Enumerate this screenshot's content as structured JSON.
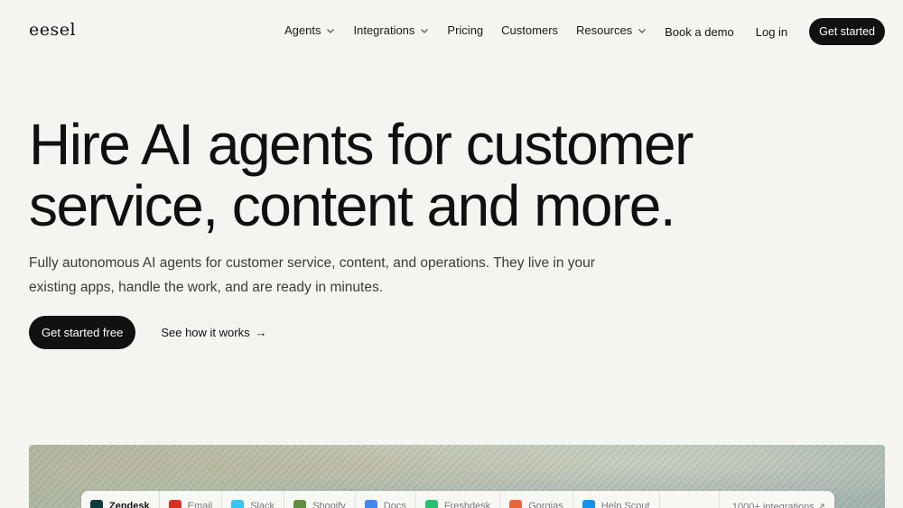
{
  "header": {
    "logo": "eesel",
    "nav": [
      {
        "label": "Agents",
        "has_dropdown": true
      },
      {
        "label": "Integrations",
        "has_dropdown": true
      },
      {
        "label": "Pricing",
        "has_dropdown": false
      },
      {
        "label": "Customers",
        "has_dropdown": false
      },
      {
        "label": "Resources",
        "has_dropdown": true
      }
    ],
    "book_demo": "Book a demo",
    "login": "Log in",
    "get_started": "Get started"
  },
  "hero": {
    "title_line1": "Hire AI agents for customer",
    "title_line2": "service, content and more.",
    "subtitle": "Fully autonomous AI agents for customer service, content, and operations. They live in your existing apps, handle the work, and are ready in minutes.",
    "cta_primary": "Get started free",
    "cta_secondary": "See how it works",
    "cta_secondary_arrow": "→"
  },
  "integrations_tabs": [
    {
      "label": "Zendesk",
      "icon": "zendesk-icon",
      "color": "#0f3b3a",
      "active": true
    },
    {
      "label": "Email",
      "icon": "gmail-icon",
      "color": "#d93025",
      "active": false
    },
    {
      "label": "Slack",
      "icon": "slack-icon",
      "color": "#36c5f0",
      "active": false
    },
    {
      "label": "Shopify",
      "icon": "shopify-icon",
      "color": "#5e8e3e",
      "active": false
    },
    {
      "label": "Docs",
      "icon": "docs-icon",
      "color": "#4285f4",
      "active": false
    },
    {
      "label": "Freshdesk",
      "icon": "freshdesk-icon",
      "color": "#25c16f",
      "active": false
    },
    {
      "label": "Gorgias",
      "icon": "gorgias-icon",
      "color": "#e8663d",
      "active": false
    },
    {
      "label": "Help Scout",
      "icon": "helpscout-icon",
      "color": "#1292ee",
      "active": false
    }
  ],
  "integrations_more": "1000+ integrations ↗",
  "colors": {
    "background": "#f4f4f0",
    "dark_button": "#111110"
  }
}
